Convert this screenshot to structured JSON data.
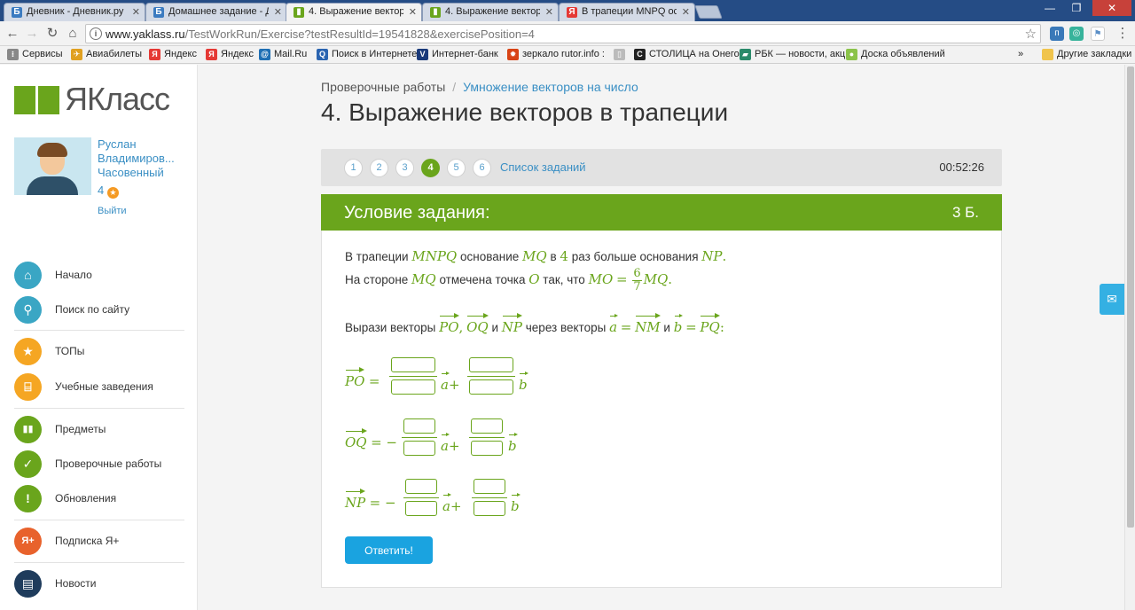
{
  "browser": {
    "tabs": [
      {
        "title": "Дневник - Дневник.ру",
        "icon": "dnevnik-favicon",
        "color": "#3b7bc0",
        "glyph": "Б"
      },
      {
        "title": "Домашнее задание - Дн",
        "icon": "dnevnik-favicon",
        "color": "#3b7bc0",
        "glyph": "Б"
      },
      {
        "title": "4. Выражение векторов",
        "icon": "yaklass-favicon",
        "color": "#6aa51c",
        "glyph": "▮"
      },
      {
        "title": "4. Выражение векторов",
        "icon": "yaklass-favicon",
        "color": "#6aa51c",
        "glyph": "▮"
      },
      {
        "title": "В трапеции MNPQ осно",
        "icon": "yandex-favicon",
        "color": "#e53935",
        "glyph": "Я"
      }
    ],
    "url_host": "www.yaklass.ru",
    "url_rest": "/TestWorkRun/Exercise?testResultId=19541828&exercisePosition=4",
    "bookmarks": [
      {
        "label": "Сервисы",
        "icon": "apps-icon",
        "color": "#888",
        "glyph": "⁝"
      },
      {
        "label": "Авиабилеты",
        "icon": "plane-icon",
        "color": "#e0a020",
        "glyph": "✈"
      },
      {
        "label": "Яндекс",
        "icon": "yandex-icon",
        "color": "#e53935",
        "glyph": "Я"
      },
      {
        "label": "Яндекс",
        "icon": "yandex-icon",
        "color": "#e53935",
        "glyph": "Я"
      },
      {
        "label": "Mail.Ru",
        "icon": "mailru-icon",
        "color": "#1f6fb4",
        "glyph": "@"
      },
      {
        "label": "Поиск в Интернете",
        "icon": "search-icon",
        "color": "#2a64b0",
        "glyph": "Q"
      },
      {
        "label": "Интернет-банк",
        "icon": "bank-icon",
        "color": "#1a3a7a",
        "glyph": "V"
      },
      {
        "label": "зеркало rutor.info :",
        "icon": "rutor-icon",
        "color": "#d84315",
        "glyph": "✹"
      },
      {
        "label": "",
        "icon": "page-icon",
        "color": "#bbb",
        "glyph": "▯"
      },
      {
        "label": "СТОЛИЦА на Онего",
        "icon": "stolica-icon",
        "color": "#222",
        "glyph": "С"
      },
      {
        "label": "РБК — новости, акц",
        "icon": "rbc-icon",
        "color": "#2a8a6a",
        "glyph": "▰"
      },
      {
        "label": "Доска объявлений",
        "icon": "avito-icon",
        "color": "#8bc34a",
        "glyph": "●"
      }
    ],
    "bookmarks_more": "»",
    "other_bookmarks": "Другие закладки"
  },
  "sidebar": {
    "logo_text": "ЯКласс",
    "user_name": "Руслан Владимиров... Часовенный",
    "user_level": "4",
    "logout": "Выйти",
    "menu": [
      {
        "label": "Начало",
        "icon": "home-icon",
        "color": "#3aa6c4",
        "glyph": "⌂"
      },
      {
        "label": "Поиск по сайту",
        "icon": "search-icon",
        "color": "#3aa6c4",
        "glyph": "⚲"
      },
      {
        "label": "ТОПы",
        "icon": "star-icon",
        "color": "#f5a623",
        "glyph": "★"
      },
      {
        "label": "Учебные заведения",
        "icon": "building-icon",
        "color": "#f5a623",
        "glyph": "⌸"
      },
      {
        "label": "Предметы",
        "icon": "book-icon",
        "color": "#6aa51c",
        "glyph": "▮▮"
      },
      {
        "label": "Проверочные работы",
        "icon": "check-icon",
        "color": "#6aa51c",
        "glyph": "✓"
      },
      {
        "label": "Обновления",
        "icon": "exclamation-icon",
        "color": "#6aa51c",
        "glyph": "!"
      },
      {
        "label": "Подписка Я+",
        "icon": "yaplus-icon",
        "color": "#e8622c",
        "glyph": "Я+"
      },
      {
        "label": "Новости",
        "icon": "news-icon",
        "color": "#1f3c5c",
        "glyph": "▤"
      }
    ]
  },
  "main": {
    "breadcrumb_root": "Проверочные работы",
    "breadcrumb_sep": "/",
    "breadcrumb_current": "Умножение векторов на число",
    "title": "4. Выражение векторов в трапеции",
    "steps": [
      "1",
      "2",
      "3",
      "4",
      "5",
      "6"
    ],
    "current_step": "4",
    "task_list": "Список заданий",
    "timer": "00:52:26",
    "condition_title": "Условие задания:",
    "points": "3 Б.",
    "answer_button": "Ответить!"
  },
  "task": {
    "l1_a": "В трапеции",
    "trap": "MNPQ",
    "l1_b": "основание",
    "base1": "MQ",
    "l1_c": "в",
    "times": "4",
    "l1_d": "раз больше основания",
    "base2": "NP",
    "l2_a": "На стороне",
    "side": "MQ",
    "l2_b": "отмечена точка",
    "point": "O",
    "l2_c": "так, что",
    "mo": "MO",
    "ratio_num": "6",
    "ratio_den": "7",
    "l3_a": "Вырази векторы",
    "v_po": "PO",
    "v_oq": "OQ",
    "and": "и",
    "v_np": "NP",
    "l3_b": "через векторы",
    "a": "a",
    "nm": "NM",
    "b": "b",
    "pq": "PQ"
  }
}
